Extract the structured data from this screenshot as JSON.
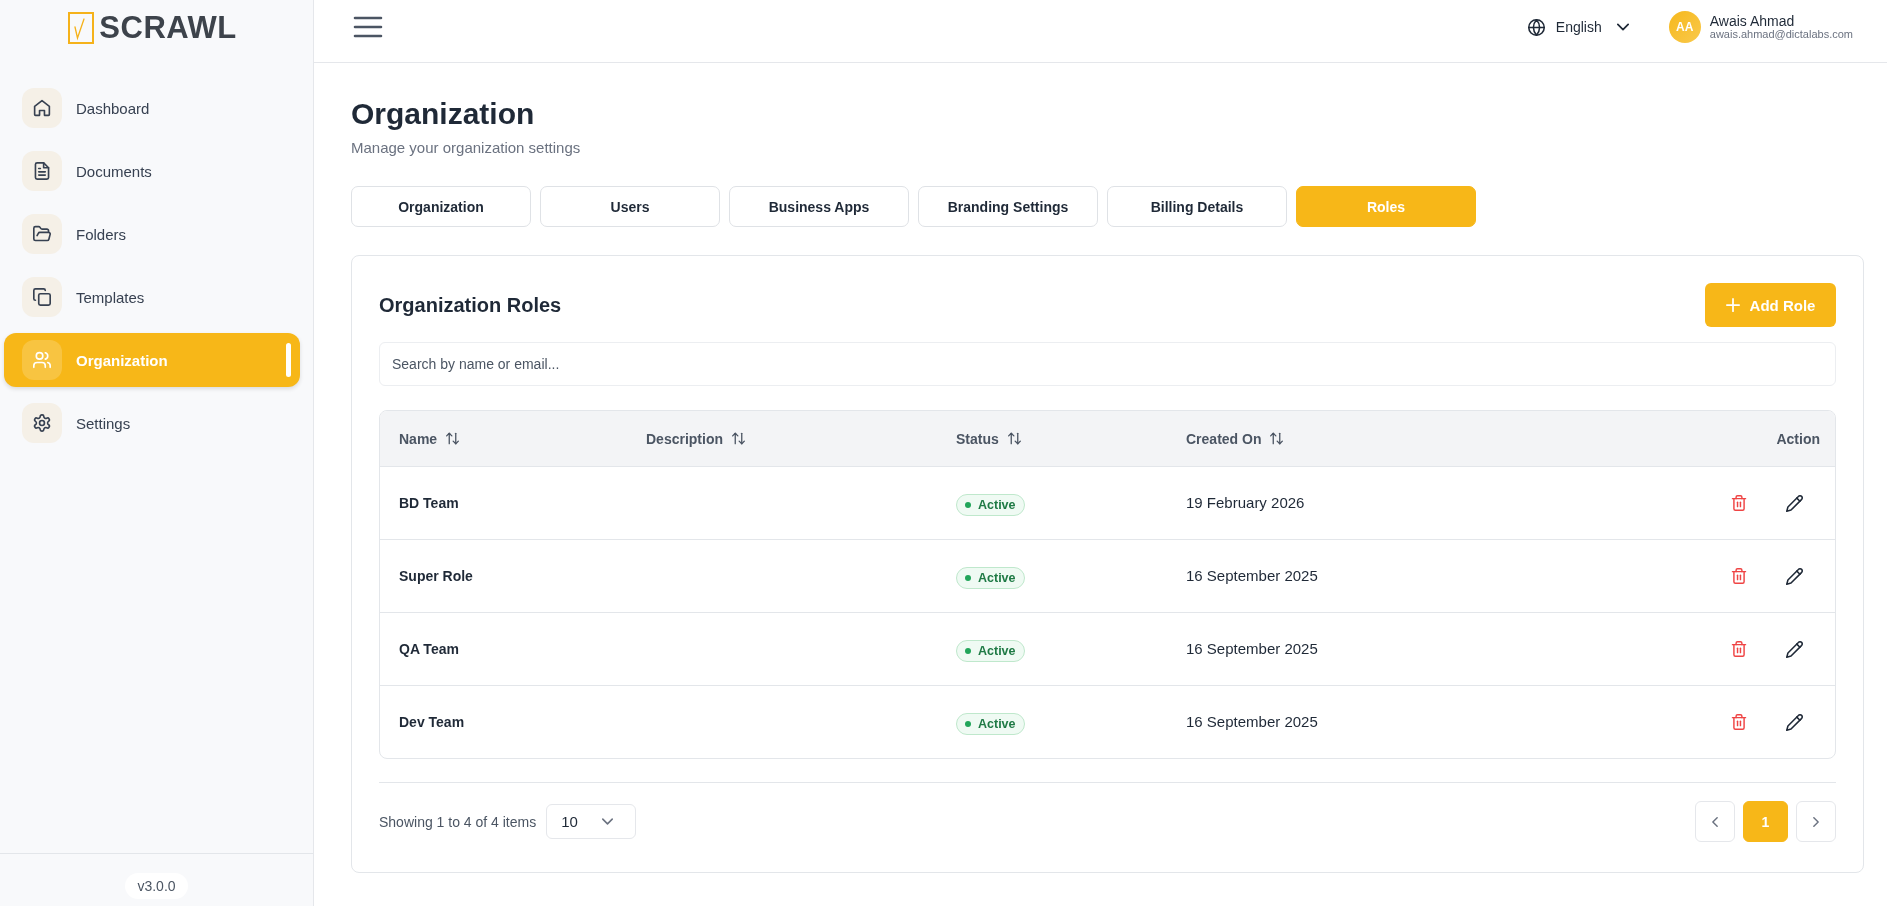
{
  "sidebar": {
    "logo": "SCRAWL",
    "items": [
      {
        "label": "Dashboard",
        "selected": false
      },
      {
        "label": "Documents",
        "selected": false
      },
      {
        "label": "Folders",
        "selected": false
      },
      {
        "label": "Templates",
        "selected": false
      },
      {
        "label": "Organization",
        "selected": true
      },
      {
        "label": "Settings",
        "selected": false
      }
    ],
    "version": "v3.0.0"
  },
  "header": {
    "language": "English",
    "user": {
      "initials": "AA",
      "name": "Awais Ahmad",
      "email": "awais.ahmad@dictalabs.com"
    }
  },
  "page": {
    "title": "Organization",
    "subtitle": "Manage your organization settings"
  },
  "tabs": [
    {
      "label": "Organization",
      "selected": false
    },
    {
      "label": "Users",
      "selected": false
    },
    {
      "label": "Business Apps",
      "selected": false
    },
    {
      "label": "Branding Settings",
      "selected": false
    },
    {
      "label": "Billing Details",
      "selected": false
    },
    {
      "label": "Roles",
      "selected": true
    }
  ],
  "card": {
    "title": "Organization Roles",
    "add_button": "Add Role",
    "search": {
      "placeholder": "Search by name or email..."
    }
  },
  "table": {
    "columns": [
      {
        "label": "Name",
        "sortable": true
      },
      {
        "label": "Description",
        "sortable": true
      },
      {
        "label": "Status",
        "sortable": true
      },
      {
        "label": "Created On",
        "sortable": true
      },
      {
        "label": "Action",
        "sortable": false
      }
    ],
    "rows": [
      {
        "name": "BD Team",
        "status": "Active",
        "created_on": "19 February 2026"
      },
      {
        "name": "Super Role",
        "status": "Active",
        "created_on": "16 September 2025"
      },
      {
        "name": "QA Team",
        "status": "Active",
        "created_on": "16 September 2025"
      },
      {
        "name": "Dev Team",
        "status": "Active",
        "created_on": "16 September 2025"
      }
    ]
  },
  "footer": {
    "summary": "Showing 1 to 4 of 4 items",
    "page_size": "10",
    "pages": [
      {
        "label": "1",
        "selected": true
      }
    ]
  }
}
